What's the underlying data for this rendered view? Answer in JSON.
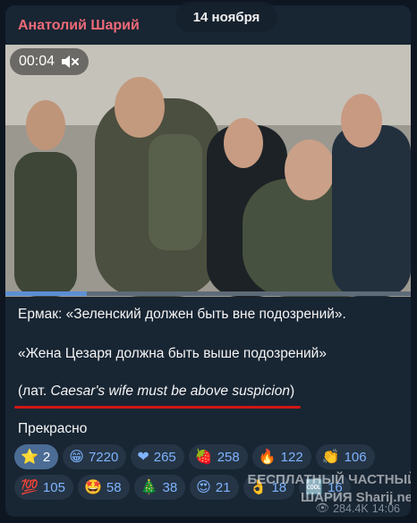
{
  "message": {
    "sender": "Анатолий Шарий",
    "date": "14 ноября",
    "video": {
      "time": "00:04",
      "muted": true,
      "progress_fraction": 0.2
    },
    "lines": [
      "Ермак: «Зеленский должен быть вне подозрений».",
      "«Жена Цезаря должна быть выше подозрений»"
    ],
    "latin_prefix": "(лат. ",
    "latin_italic": "Caesar's wife must be above suspicion",
    "latin_suffix": ")",
    "footer": "Прекрасно",
    "meta": {
      "views": "284.4K",
      "time": "14:06"
    }
  },
  "reactions": [
    [
      {
        "emoji": "⭐",
        "count": "2",
        "selected": true
      },
      {
        "emoji": "😁",
        "count": "7220"
      },
      {
        "emoji": "❤",
        "count": "265"
      },
      {
        "emoji": "🍓",
        "count": "258"
      },
      {
        "emoji": "🔥",
        "count": "122"
      },
      {
        "emoji": "👏",
        "count": "106"
      }
    ],
    [
      {
        "emoji": "💯",
        "count": "105"
      },
      {
        "emoji": "🤩",
        "count": "58"
      },
      {
        "emoji": "🎄",
        "count": "38"
      },
      {
        "emoji": "😍",
        "count": "21"
      },
      {
        "emoji": "👌",
        "count": "18"
      },
      {
        "emoji": "🆒",
        "count": "16"
      }
    ]
  ],
  "watermark": {
    "line1": "БЕСПЛАТНЫЙ ЧАСТНЫЙ",
    "line2": "ШАРИЯ Sharij.net"
  },
  "colors": {
    "bg": "#0e1621",
    "bubble": "#182533",
    "sender": "#ee6a77",
    "accent": "#5b8fd4",
    "underline": "#d01616"
  }
}
